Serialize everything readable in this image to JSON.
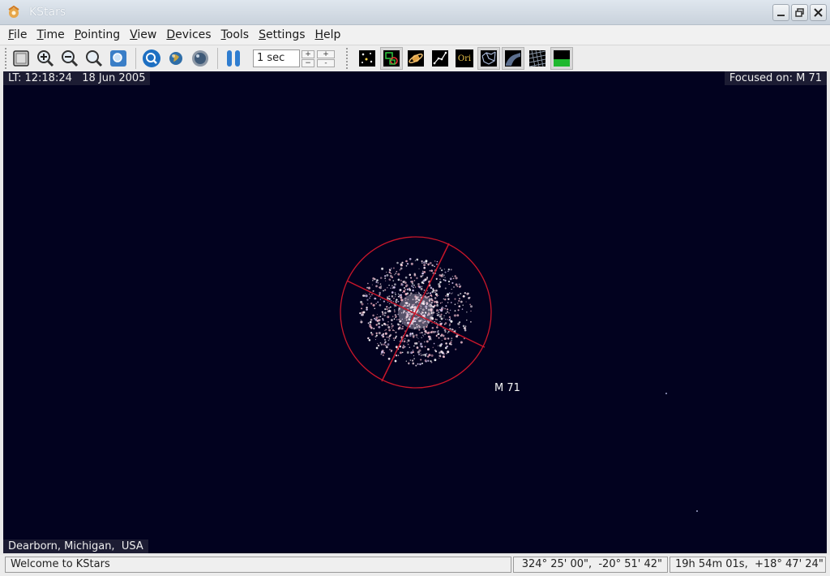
{
  "window": {
    "title": "KStars"
  },
  "menubar": {
    "items": [
      {
        "label": "File",
        "ul": "F",
        "rest": "ile"
      },
      {
        "label": "Time",
        "ul": "T",
        "rest": "ime"
      },
      {
        "label": "Pointing",
        "ul": "P",
        "rest": "ointing"
      },
      {
        "label": "View",
        "ul": "V",
        "rest": "iew"
      },
      {
        "label": "Devices",
        "ul": "D",
        "rest": "evices"
      },
      {
        "label": "Tools",
        "ul": "T",
        "rest": "ools"
      },
      {
        "label": "Settings",
        "ul": "S",
        "rest": "ettings"
      },
      {
        "label": "Help",
        "ul": "H",
        "rest": "elp"
      }
    ]
  },
  "toolbar": {
    "timestep_value": "1 sec",
    "spin_up": "+",
    "spin_down": "−",
    "step_up": "+",
    "step_down": "-",
    "constellation_names_label": "Ori"
  },
  "skymap": {
    "local_time": "LT: 12:18:24   18 Jun 2005",
    "focused_on": "Focused on: M 71",
    "object_label": "M 71",
    "location": "Dearborn, Michigan,  USA"
  },
  "statusbar": {
    "message": "Welcome to KStars",
    "alt_az": "324° 25' 00\",  -20° 51' 42\"",
    "ra_dec": "19h 54m 01s,  +18° 47' 24\""
  },
  "colors": {
    "sky_background": "#02021f",
    "info_box_background": "#1c1c33",
    "target_circle": "#c8162a"
  }
}
